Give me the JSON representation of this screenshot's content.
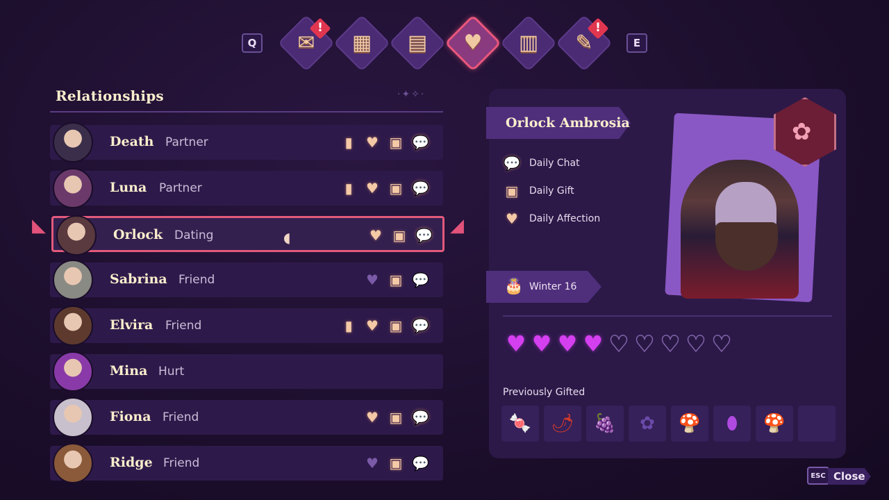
{
  "top_tabs": {
    "prev_key": "Q",
    "next_key": "E",
    "tabs": [
      {
        "icon": "quest-scroll-icon",
        "glyph": "✉",
        "alert": "!"
      },
      {
        "icon": "map-icon",
        "glyph": "▦",
        "alert": ""
      },
      {
        "icon": "calendar-icon",
        "glyph": "▤",
        "alert": ""
      },
      {
        "icon": "heart-icon",
        "glyph": "♥",
        "alert": "",
        "active": true
      },
      {
        "icon": "book-icon",
        "glyph": "▥",
        "alert": ""
      },
      {
        "icon": "journal-icon",
        "glyph": "✎",
        "alert": "!"
      }
    ]
  },
  "relationships": {
    "title": "Relationships",
    "sparkle": "·✦✧·",
    "selected_index": 2,
    "rows": [
      {
        "name": "Death",
        "status": "Partner",
        "icons": [
          "bookmark",
          "heart",
          "gift",
          "chat"
        ],
        "dim": [
          false,
          false,
          false,
          false
        ],
        "portrait_color": "#3b2e4a"
      },
      {
        "name": "Luna",
        "status": "Partner",
        "icons": [
          "bookmark",
          "heart",
          "gift",
          "chat"
        ],
        "dim": [
          false,
          false,
          false,
          false
        ],
        "portrait_color": "#6b3a6a"
      },
      {
        "name": "Orlock",
        "status": "Dating",
        "icons": [
          "heart",
          "gift",
          "chat"
        ],
        "dim": [
          false,
          false,
          false
        ],
        "portrait_color": "#5a3a3e"
      },
      {
        "name": "Sabrina",
        "status": "Friend",
        "icons": [
          "heart",
          "gift",
          "chat"
        ],
        "dim": [
          true,
          false,
          true
        ],
        "portrait_color": "#8a8a84"
      },
      {
        "name": "Elvira",
        "status": "Friend",
        "icons": [
          "bookmark",
          "heart",
          "gift",
          "chat"
        ],
        "dim": [
          false,
          false,
          false,
          false
        ],
        "portrait_color": "#5e3a2e"
      },
      {
        "name": "Mina",
        "status": "Hurt",
        "icons": [],
        "dim": [],
        "portrait_color": "#8a3aa8"
      },
      {
        "name": "Fiona",
        "status": "Friend",
        "icons": [
          "heart",
          "gift",
          "chat"
        ],
        "dim": [
          false,
          false,
          false
        ],
        "portrait_color": "#c8c0cc"
      },
      {
        "name": "Ridge",
        "status": "Friend",
        "icons": [
          "heart",
          "gift",
          "chat"
        ],
        "dim": [
          true,
          false,
          true
        ],
        "portrait_color": "#8a5a3a"
      }
    ]
  },
  "detail": {
    "name": "Orlock Ambrosia",
    "dailies": [
      {
        "icon": "chat-icon",
        "glyph": "💬",
        "label": "Daily Chat"
      },
      {
        "icon": "gift-icon",
        "glyph": "▣",
        "label": "Daily Gift"
      },
      {
        "icon": "heart-icon",
        "glyph": "♥",
        "label": "Daily Affection"
      }
    ],
    "birthday": "Winter 16",
    "hearts_filled": 4,
    "hearts_total": 9,
    "gift_title": "Previously Gifted",
    "gifts": [
      {
        "icon": "candy-icon",
        "glyph": "🍬",
        "color": "#3a6ce0"
      },
      {
        "icon": "chili-pepper-icon",
        "glyph": "🌶",
        "color": "#d63a2a"
      },
      {
        "icon": "grapes-icon",
        "glyph": "🍇",
        "color": "#8aa4e0"
      },
      {
        "icon": "dark-flower-icon",
        "glyph": "✿",
        "color": "#6a4aa8"
      },
      {
        "icon": "mushroom-icon",
        "glyph": "🍄",
        "color": "#b07a3a"
      },
      {
        "icon": "egg-icon",
        "glyph": "⬮",
        "color": "#b04ae0"
      },
      {
        "icon": "mushroom-icon",
        "glyph": "🍄",
        "color": "#b07a3a"
      },
      {
        "icon": "empty-slot",
        "glyph": "",
        "color": "#000"
      }
    ]
  },
  "footer": {
    "close_key": "ESC",
    "close_label": "Close"
  }
}
